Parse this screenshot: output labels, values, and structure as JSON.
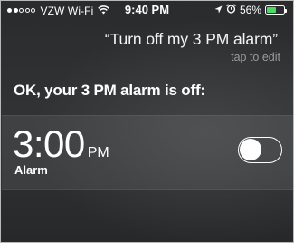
{
  "status_bar": {
    "signal_bars_filled": 2,
    "signal_bars_total": 5,
    "carrier": "VZW Wi-Fi",
    "time": "9:40 PM",
    "battery_percent": "56%",
    "battery_level": 0.56,
    "battery_color": "#4cd964",
    "icons": [
      "signal-dots",
      "wifi-icon",
      "location-arrow-icon",
      "alarm-clock-icon",
      "battery-icon"
    ]
  },
  "siri": {
    "query": "“Turn off my 3 PM alarm”",
    "tap_to_edit": "tap to edit",
    "response": "OK, your 3 PM alarm is off:"
  },
  "alarm": {
    "time": "3:00",
    "ampm": "PM",
    "label": "Alarm",
    "enabled": false
  }
}
